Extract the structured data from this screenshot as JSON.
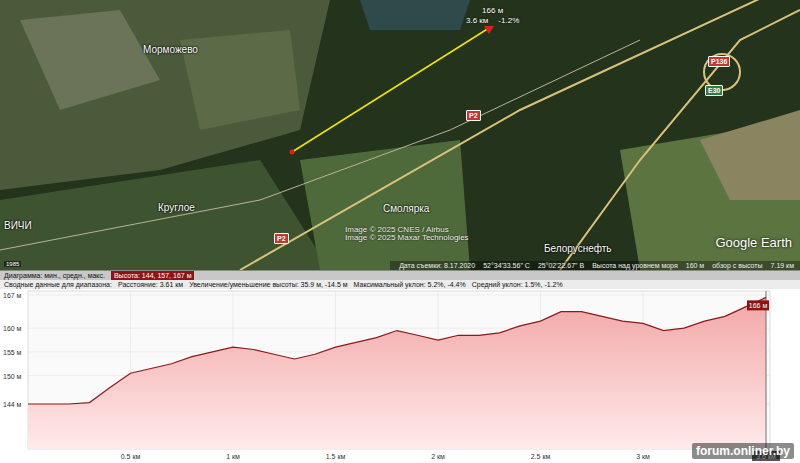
{
  "map": {
    "places": [
      "Морможево",
      "Круглое",
      "ВИЧИ",
      "Смолярка",
      "Белоруснефть"
    ],
    "road_signs": [
      "P2",
      "P2",
      "P136",
      "E30"
    ],
    "credits": [
      "Image © 2025 CNES / Airbus",
      "Image © 2025 Maxar Technologies"
    ],
    "logo": "Google Earth",
    "year": "1985",
    "marker": {
      "elevation": "166 м",
      "distance": "3.6 км",
      "grade": "-1.2%"
    },
    "status": [
      "Дата съемки: 8.17.2020",
      "52°34'33.56\" С",
      "25°02'22.67\" В",
      "Высота над уровнем моря",
      "160 м",
      "обзор с высоты",
      "7.19 км"
    ]
  },
  "profile": {
    "header": {
      "label": "Диаграмма: мин., средн., макс.",
      "highlight": "Высота: 144, 157, 167 м"
    },
    "summary": [
      "Сводные данные для диапазона:",
      "Расстояние: 3.61 км",
      "Увеличение/уменьшение высоты: 35.9 м, -14.5 м",
      "Максимальный уклон: 5.2%, -4.4%",
      "Средний уклон: 1.5%, -1.2%"
    ],
    "chart": {
      "y_ticks": [
        {
          "value": 167,
          "label": "167 м"
        },
        {
          "value": 160,
          "label": "160 м"
        },
        {
          "value": 155,
          "label": "155 м"
        },
        {
          "value": 150,
          "label": "150 м"
        },
        {
          "value": 144,
          "label": "144 м"
        }
      ],
      "x_ticks": [
        {
          "value": 0.5,
          "label": "0.5 км"
        },
        {
          "value": 1,
          "label": "1 км"
        },
        {
          "value": 1.5,
          "label": "1.5 км"
        },
        {
          "value": 2,
          "label": "2 км"
        },
        {
          "value": 2.5,
          "label": "2.5 км"
        },
        {
          "value": 3,
          "label": "3 км"
        },
        {
          "value": 3.6,
          "label": "3.6 км"
        }
      ],
      "series": [
        {
          "name": "elevation",
          "step_km": 0.1,
          "values": [
            144,
            144,
            144,
            144.3,
            147.5,
            150.5,
            151.5,
            152.5,
            154,
            155,
            156,
            155.5,
            154.5,
            153.5,
            154.5,
            156,
            157,
            158,
            159.5,
            158.5,
            157.5,
            158.5,
            158.5,
            159,
            160.5,
            161.5,
            163.5,
            163.5,
            162.5,
            161.5,
            161,
            159.5,
            160,
            161.5,
            162.5,
            164.5,
            166.5
          ]
        }
      ],
      "end_label": "166 м"
    }
  },
  "watermark": "forum.onliner.by"
}
